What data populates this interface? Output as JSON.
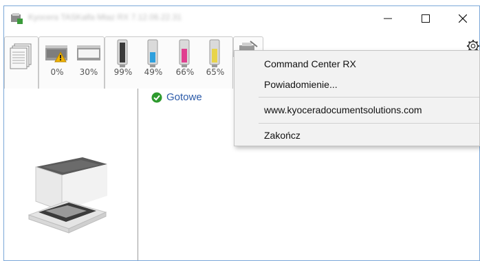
{
  "window": {
    "title": "Kyocera TASKalfa Mtaz RX 7.12.06.22.31"
  },
  "window_controls": {
    "minimize": "—",
    "maximize": "☐",
    "close": "✕"
  },
  "toolbar": {
    "paper_levels": [
      "0%",
      "30%"
    ],
    "toner_levels": [
      "99%",
      "49%",
      "66%",
      "65%"
    ],
    "toner_colors": [
      "#3a3a3a",
      "#2fa0dd",
      "#e0408f",
      "#e8d44a"
    ],
    "warning_color": "#f2b400"
  },
  "status": {
    "text": "Gotowe",
    "icon": "check-circle-icon",
    "color": "#2e9a2e"
  },
  "context_menu": {
    "items": [
      "Command Center RX",
      "Powiadomienie...",
      "www.kyoceradocumentsolutions.com",
      "Zakończ"
    ]
  }
}
